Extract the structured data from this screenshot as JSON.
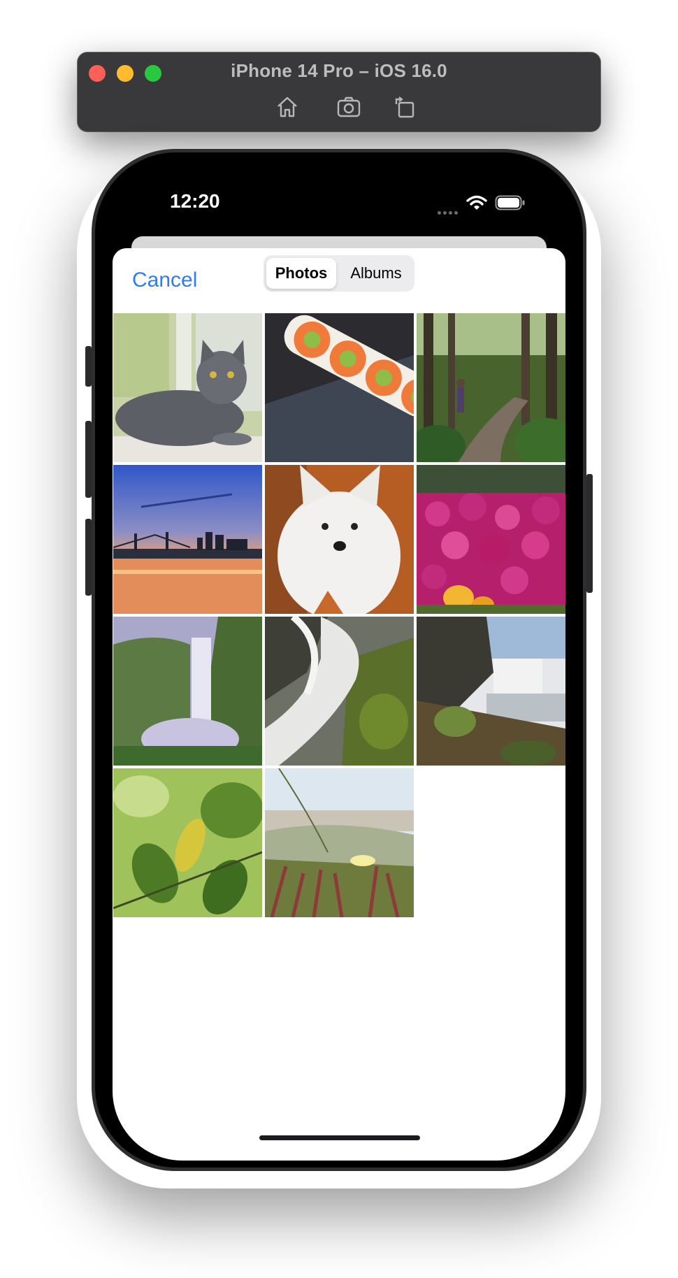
{
  "simulator": {
    "title": "iPhone 14 Pro – iOS 16.0",
    "toolbar_icons": [
      "home-icon",
      "screenshot-icon",
      "rotate-icon"
    ]
  },
  "status_bar": {
    "time": "12:20",
    "icons": [
      "signal-dots-icon",
      "wifi-icon",
      "battery-icon"
    ]
  },
  "picker": {
    "cancel_label": "Cancel",
    "segments": [
      {
        "label": "Photos",
        "selected": true
      },
      {
        "label": "Albums",
        "selected": false
      }
    ],
    "photos": [
      {
        "subject": "gray cat on windowsill"
      },
      {
        "subject": "sushi rolls"
      },
      {
        "subject": "forest trail hiker"
      },
      {
        "subject": "bay bridge at sunset"
      },
      {
        "subject": "white fluffy dog"
      },
      {
        "subject": "pink flower field"
      },
      {
        "subject": "waterfall in green valley"
      },
      {
        "subject": "long exposure waterfall"
      },
      {
        "subject": "waterfall with mossy rocks"
      },
      {
        "subject": "green leaves"
      },
      {
        "subject": "beach dune flowers"
      }
    ]
  },
  "colors": {
    "accent": "#2f7bf0",
    "toolbar": "#39393c",
    "segment_bg": "#ececee"
  }
}
